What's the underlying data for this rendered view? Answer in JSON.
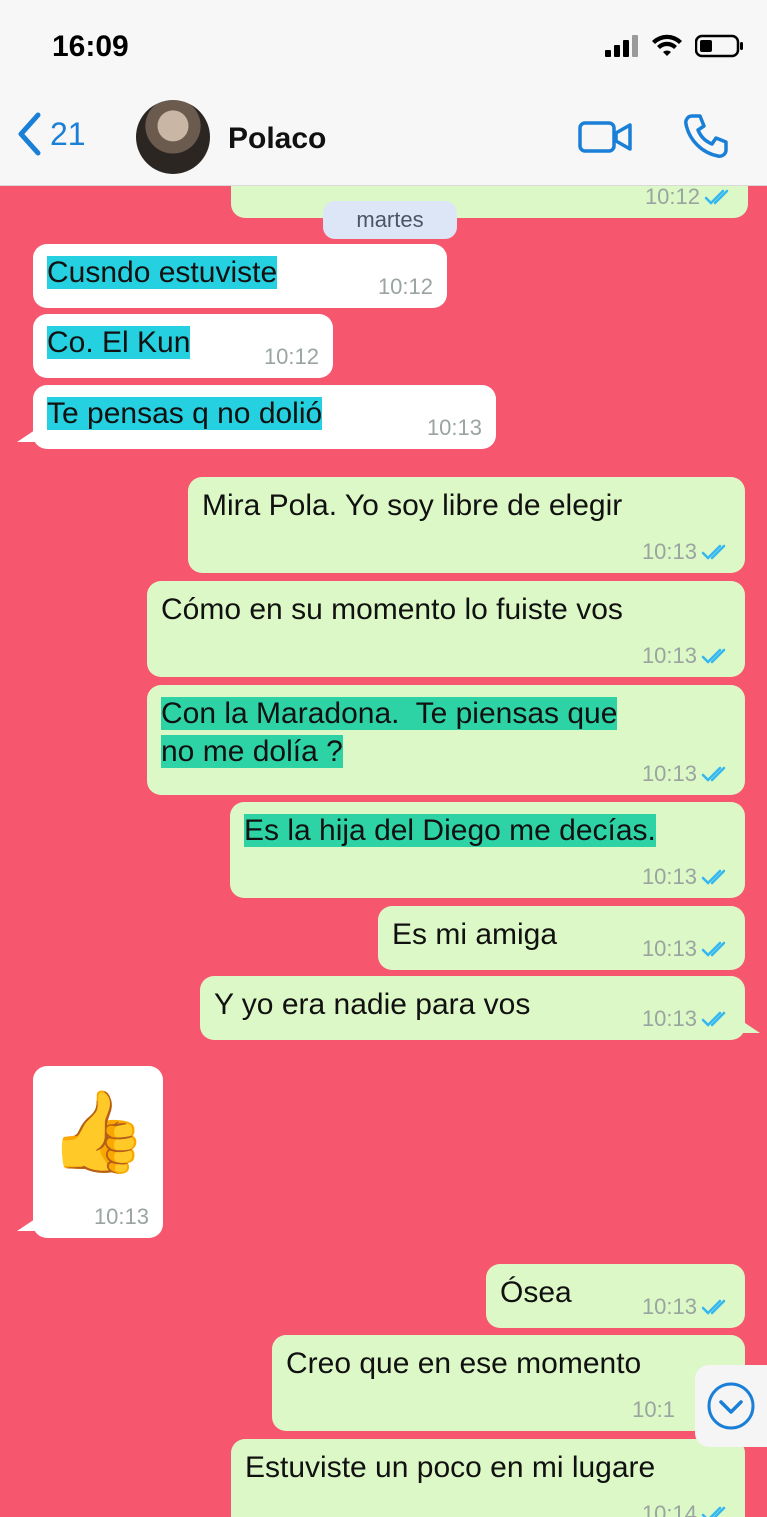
{
  "status_bar": {
    "time": "16:09"
  },
  "header": {
    "back_count": "21",
    "contact_name": "Polaco"
  },
  "chat": {
    "date_separator": "martes",
    "top_partial_time": "10:12",
    "messages": [
      {
        "text": "Cusndo estuviste",
        "time": "10:12"
      },
      {
        "text": "Co. El Kun",
        "time": "10:12"
      },
      {
        "text": "Te pensas q no dolió",
        "time": "10:13"
      },
      {
        "text": "Mira Pola. Yo soy libre de elegir",
        "time": "10:13"
      },
      {
        "text": "Cómo en su momento lo fuiste vos",
        "time": "10:13"
      },
      {
        "text": "Con la Maradona.  Te piensas que",
        "text2": "no me dolía ?",
        "time": "10:13"
      },
      {
        "text": "Es la hija del Diego me decías.",
        "time": "10:13"
      },
      {
        "text": "Es mi amiga",
        "time": "10:13"
      },
      {
        "text": "Y yo era nadie para vos",
        "time": "10:13"
      },
      {
        "emoji": "👍",
        "time": "10:13"
      },
      {
        "text": "Ósea",
        "time": "10:13"
      },
      {
        "text": "Creo que en ese momento",
        "time": "10:1"
      },
      {
        "text": "Estuviste un poco en mi lugare",
        "time": "10:14"
      }
    ]
  },
  "colors": {
    "chat_background": "#f7566f",
    "incoming_bubble": "#ffffff",
    "outgoing_bubble": "#dcf8c6",
    "incoming_highlight": "#25d0e0",
    "outgoing_highlight": "#2ed3a5",
    "ios_blue": "#1a7fd6",
    "read_tick": "#34b7f1"
  },
  "icons": {
    "back": "chevron-left-icon",
    "video": "video-camera-icon",
    "call": "phone-icon",
    "read": "double-check-icon",
    "scroll": "chevron-down-circle-icon"
  }
}
